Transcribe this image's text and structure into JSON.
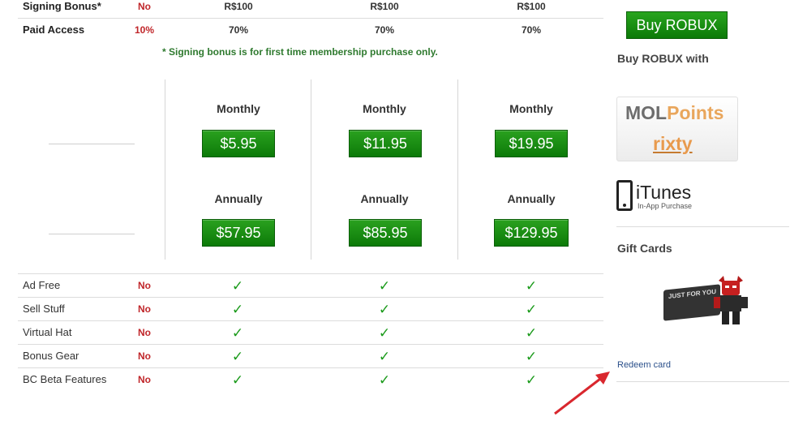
{
  "top_rows": {
    "signing_bonus": {
      "label": "Signing Bonus*",
      "free": "No",
      "tier1": "R$100",
      "tier2": "R$100",
      "tier3": "R$100"
    },
    "paid_access": {
      "label": "Paid Access",
      "free": "10%",
      "tier1": "70%",
      "tier2": "70%",
      "tier3": "70%"
    }
  },
  "note": "* Signing bonus is for first time membership purchase only.",
  "plans": [
    {
      "monthly_label": "Monthly",
      "monthly_price": "$5.95",
      "annual_label": "Annually",
      "annual_price": "$57.95"
    },
    {
      "monthly_label": "Monthly",
      "monthly_price": "$11.95",
      "annual_label": "Annually",
      "annual_price": "$85.95"
    },
    {
      "monthly_label": "Monthly",
      "monthly_price": "$19.95",
      "annual_label": "Annually",
      "annual_price": "$129.95"
    }
  ],
  "features": [
    {
      "label": "Ad Free",
      "free": "No"
    },
    {
      "label": "Sell Stuff",
      "free": "No"
    },
    {
      "label": "Virtual Hat",
      "free": "No"
    },
    {
      "label": "Bonus Gear",
      "free": "No"
    },
    {
      "label": "BC Beta Features",
      "free": "No"
    }
  ],
  "check_symbol": "✓",
  "sidebar": {
    "buy_button": "Buy ROBUX",
    "buy_with": "Buy ROBUX with",
    "mol_a": "MOL",
    "mol_b": "Points",
    "rixty": "rixty",
    "itunes_title": "iTunes",
    "itunes_sub": "In-App Purchase",
    "gift_cards": "Gift Cards",
    "gift_card_text": "JUST FOR YOU",
    "redeem": "Redeem card"
  },
  "colors": {
    "accent_green": "#0c7a08",
    "no_red": "#c0262a",
    "link_blue": "#2a4f8a",
    "arrow_red": "#d9272e"
  }
}
